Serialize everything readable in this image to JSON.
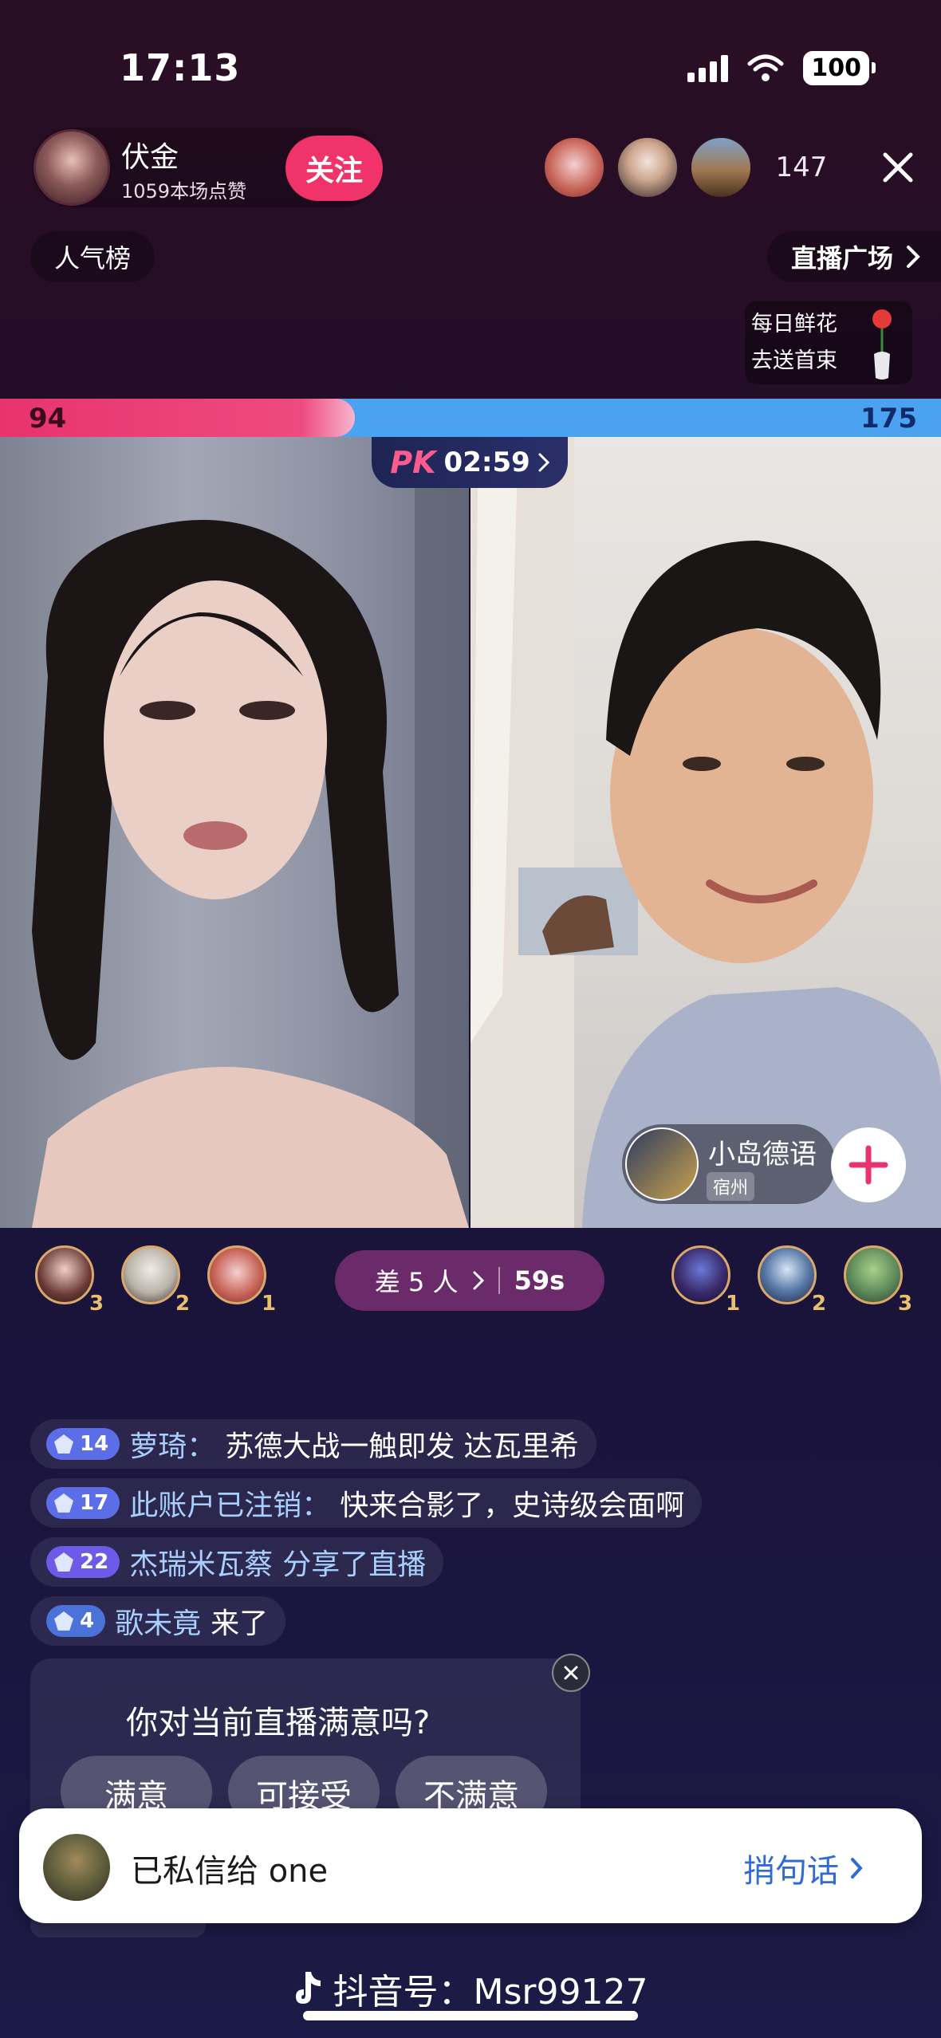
{
  "status_bar": {
    "time": "17:13",
    "battery": "100"
  },
  "host": {
    "name": "伏金",
    "likes": "1059本场点赞",
    "follow_label": "关注"
  },
  "viewers": {
    "count": "147"
  },
  "top_row": {
    "rank_label": "人气榜",
    "plaza_label": "直播广场"
  },
  "flower": {
    "line1": "每日鲜花",
    "line2": "去送首束"
  },
  "pk": {
    "left_score": "94",
    "right_score": "175",
    "left_fraction": 0.35,
    "timer": "02:59",
    "logo": "PK"
  },
  "opponent": {
    "name": "小岛德语",
    "location": "宿州"
  },
  "contributors": {
    "left": [
      {
        "rank": "3"
      },
      {
        "rank": "2"
      },
      {
        "rank": "1"
      }
    ],
    "right": [
      {
        "rank": "1"
      },
      {
        "rank": "2"
      },
      {
        "rank": "3"
      }
    ]
  },
  "diff": {
    "label": "差 5 人",
    "countdown": "59s"
  },
  "chat": [
    {
      "level": "14",
      "user": "萝琦：",
      "message": "苏德大战一触即发 达瓦里希",
      "badge_color": "#5b6ee8"
    },
    {
      "level": "17",
      "user": "此账户已注销：",
      "message": "快来合影了，史诗级会面啊",
      "badge_color": "#5b6ee8"
    },
    {
      "level": "22",
      "user": "杰瑞米瓦蔡",
      "message": "分享了直播",
      "badge_color": "#6d5ae8"
    },
    {
      "level": "4",
      "user": "歌未竟",
      "message": "来了",
      "badge_color": "#4a72d8"
    }
  ],
  "survey": {
    "question": "你对当前直播满意吗?",
    "options": [
      "满意",
      "可接受",
      "不满意"
    ]
  },
  "toast": {
    "text": "已私信给 one",
    "action": "捎句话"
  },
  "watermark": {
    "label": "抖音号：Msr99127"
  },
  "colors": {
    "follow_pink": "#f0346a",
    "pk_red": "#e8336e",
    "pk_blue": "#4aa2f0",
    "toast_action": "#2e6bd6"
  }
}
